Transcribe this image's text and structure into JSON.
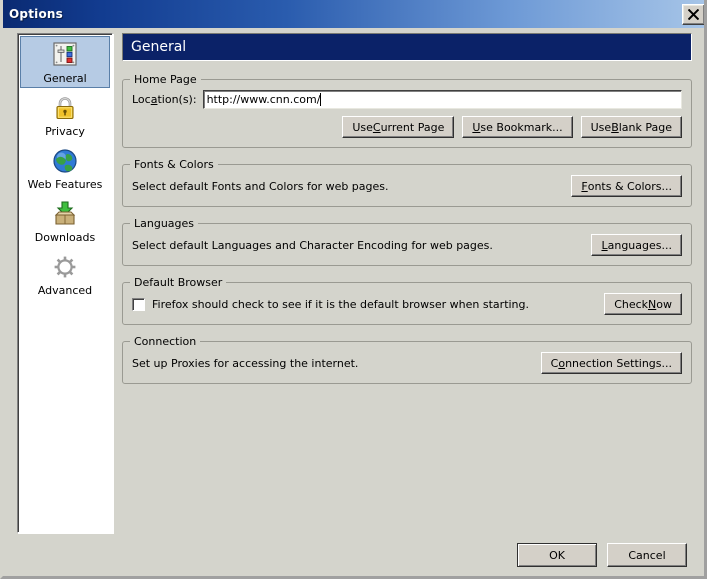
{
  "window": {
    "title": "Options",
    "close_label": "×",
    "close_icon": "close-icon"
  },
  "sidebar": {
    "items": [
      {
        "label": "General",
        "icon": "sliders-panel-icon",
        "selected": true
      },
      {
        "label": "Privacy",
        "icon": "padlock-icon",
        "selected": false
      },
      {
        "label": "Web Features",
        "icon": "globe-icon",
        "selected": false
      },
      {
        "label": "Downloads",
        "icon": "download-box-icon",
        "selected": false
      },
      {
        "label": "Advanced",
        "icon": "gear-icon",
        "selected": false
      }
    ]
  },
  "pane": {
    "header": "General",
    "groups": {
      "home_page": {
        "title": "Home Page",
        "location_label_pre": "Loc",
        "location_label_accel": "a",
        "location_label_post": "tion(s):",
        "location_value": "http://www.cnn.com/",
        "location_placeholder": "",
        "buttons": [
          {
            "pre": "Use ",
            "accel": "C",
            "post": "urrent Page"
          },
          {
            "pre": "",
            "accel": "U",
            "post": "se Bookmark..."
          },
          {
            "pre": "Use ",
            "accel": "B",
            "post": "lank Page"
          }
        ]
      },
      "fonts_colors": {
        "title": "Fonts & Colors",
        "description": "Select default Fonts and Colors for web pages.",
        "button": {
          "pre": "",
          "accel": "F",
          "post": "onts & Colors..."
        }
      },
      "languages": {
        "title": "Languages",
        "description": "Select default Languages and Character Encoding for web pages.",
        "button": {
          "pre": "",
          "accel": "L",
          "post": "anguages..."
        }
      },
      "default_browser": {
        "title": "Default Browser",
        "checkbox_label": "Firefox should check to see if it is the default browser when starting.",
        "checkbox_checked": false,
        "button": {
          "pre": "Check ",
          "accel": "N",
          "post": "ow"
        }
      },
      "connection": {
        "title": "Connection",
        "description": "Set up Proxies for accessing the internet.",
        "button": {
          "pre": "C",
          "accel": "o",
          "post": "nnection Settings..."
        }
      }
    }
  },
  "footer": {
    "ok_label": "OK",
    "cancel_label": "Cancel"
  },
  "colors": {
    "dialog_bg": "#d4d4cc",
    "titlebar_start": "#0a2a72",
    "titlebar_end": "#a8c6e8",
    "pane_header_bg": "#0b2268",
    "selection_bg": "#b6cbe4",
    "button_face": "#d4d0c8"
  }
}
